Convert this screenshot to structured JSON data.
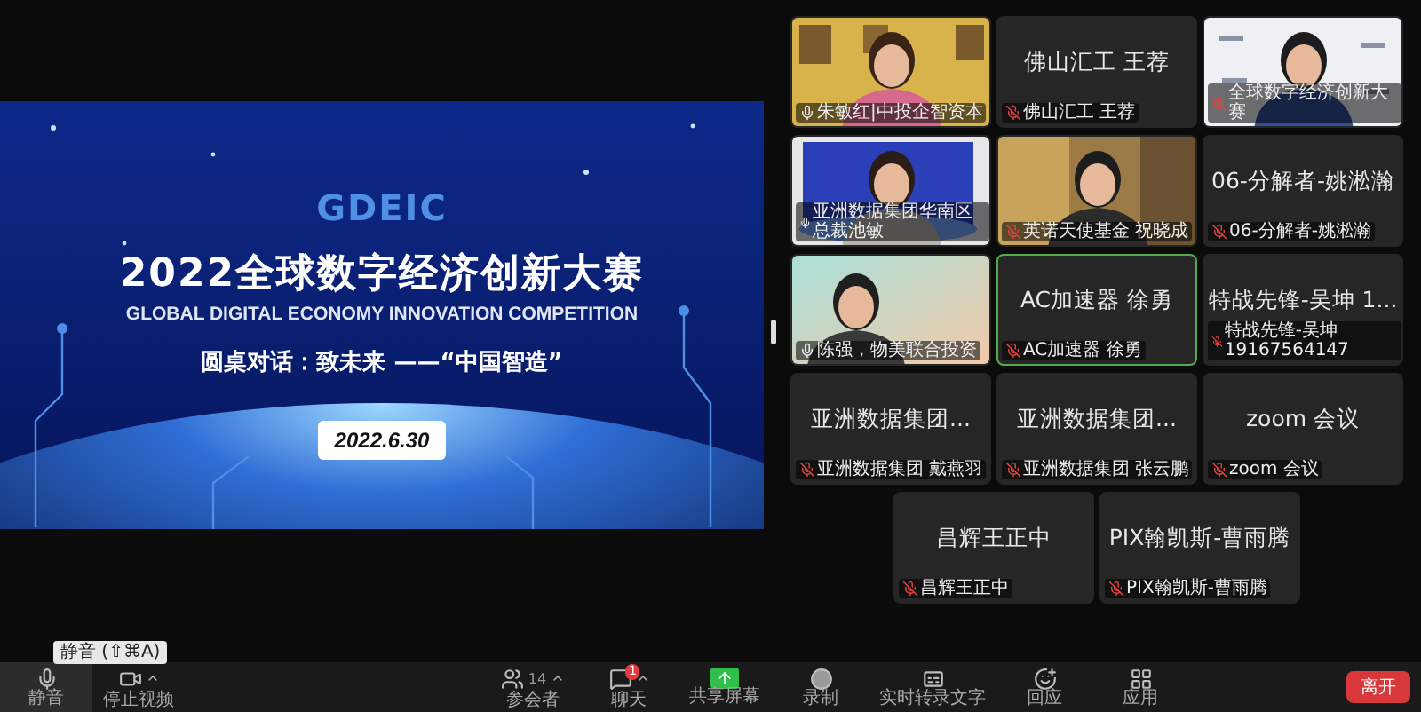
{
  "slide": {
    "logo": "GDEIC",
    "title": "2022全球数字经济创新大赛",
    "subtitle": "GLOBAL DIGITAL ECONOMY INNOVATION COMPETITION",
    "topic": "圆桌对话：致未来 ——“中国智造”",
    "date": "2022.6.30"
  },
  "tiles": [
    {
      "kind": "video",
      "label": "朱敏红|中投企智资本",
      "muted": false,
      "speaking": false
    },
    {
      "kind": "name",
      "name": "佛山汇工 王荐",
      "label": "佛山汇工 王荐",
      "muted": true,
      "speaking": false
    },
    {
      "kind": "video",
      "label": "全球数字经济创新大赛",
      "muted": true,
      "speaking": false
    },
    {
      "kind": "video",
      "label": "亚洲数据集团华南区总裁池敏",
      "muted": false,
      "speaking": false
    },
    {
      "kind": "video",
      "label": "英诺天使基金 祝晓成",
      "muted": true,
      "speaking": false
    },
    {
      "kind": "name",
      "name": "06-分解者-姚淞瀚",
      "label": "06-分解者-姚淞瀚",
      "muted": true,
      "speaking": false
    },
    {
      "kind": "video",
      "label": "陈强，物美联合投资",
      "muted": false,
      "speaking": false
    },
    {
      "kind": "name",
      "name": "AC加速器 徐勇",
      "label": "AC加速器 徐勇",
      "muted": true,
      "speaking": true
    },
    {
      "kind": "name",
      "name": "特战先锋-吴坤 1...",
      "label": "特战先锋-吴坤 19167564147",
      "muted": true,
      "speaking": false
    },
    {
      "kind": "name",
      "name": "亚洲数据集团...",
      "label": "亚洲数据集团 戴燕羽",
      "muted": true,
      "speaking": false
    },
    {
      "kind": "name",
      "name": "亚洲数据集团...",
      "label": "亚洲数据集团 张云鹏",
      "muted": true,
      "speaking": false
    },
    {
      "kind": "name",
      "name": "zoom 会议",
      "label": "zoom 会议",
      "muted": true,
      "speaking": false
    }
  ],
  "last_row": [
    {
      "kind": "name",
      "name": "昌辉王正中",
      "label": "昌辉王正中",
      "muted": true,
      "speaking": false
    },
    {
      "kind": "name",
      "name": "PIX翰凯斯-曹雨腾",
      "label": "PIX翰凯斯-曹雨腾",
      "muted": true,
      "speaking": false
    }
  ],
  "toolbar": {
    "tooltip": "静音 (⇧⌘A)",
    "left": [
      {
        "kind": "mic",
        "label": "静音",
        "selected": true
      },
      {
        "kind": "video",
        "label": "停止视频",
        "selected": false
      }
    ],
    "center": [
      {
        "kind": "participants",
        "label": "参会者",
        "count": "14"
      },
      {
        "kind": "chat",
        "label": "聊天",
        "badge": "1"
      },
      {
        "kind": "share",
        "label": "共享屏幕"
      },
      {
        "kind": "record",
        "label": "录制"
      },
      {
        "kind": "captions",
        "label": "实时转录文字"
      },
      {
        "kind": "reactions",
        "label": "回应"
      },
      {
        "kind": "apps",
        "label": "应用"
      }
    ],
    "leave": "离开"
  }
}
